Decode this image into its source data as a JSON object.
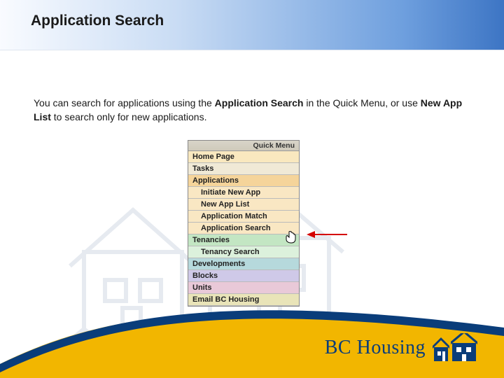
{
  "title": "Application Search",
  "body": {
    "pre": "You can search for applications using the ",
    "bold1": "Application Search",
    "mid": " in the Quick Menu, or use ",
    "bold2": "New App List",
    "post": " to search only for new applications."
  },
  "quickMenu": {
    "header": "Quick Menu",
    "items": {
      "home": "Home Page",
      "tasks": "Tasks",
      "applications": "Applications",
      "initiate": "Initiate New App",
      "newapplist": "New App List",
      "appmatch": "Application Match",
      "appsearch": "Application Search",
      "tenancies": "Tenancies",
      "tenancysearch": "Tenancy Search",
      "developments": "Developments",
      "blocks": "Blocks",
      "units": "Units",
      "emailbc": "Email BC Housing"
    }
  },
  "logo": {
    "text": "BC Housing"
  }
}
